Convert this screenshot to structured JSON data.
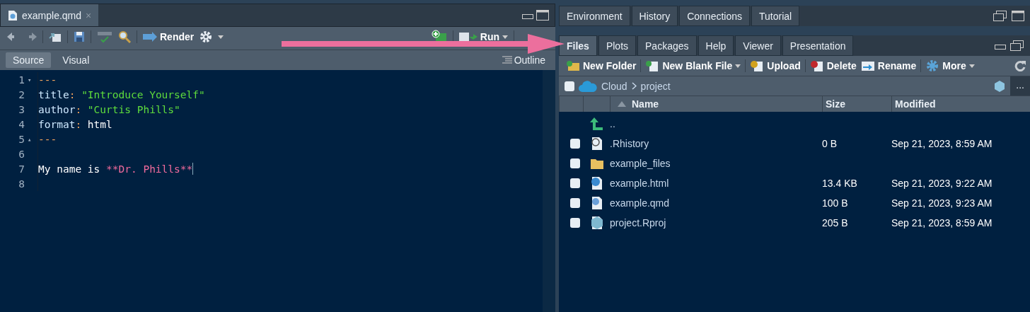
{
  "editor": {
    "file_tab": {
      "label": "example.qmd",
      "close": "×"
    },
    "toolbar": {
      "render": "Render",
      "run": "Run"
    },
    "mode_tabs": [
      {
        "label": "Source",
        "selected": true
      },
      {
        "label": "Visual",
        "selected": false
      }
    ],
    "outline": "Outline",
    "lines": [
      {
        "number": "1",
        "fold": "▾",
        "tokens": [
          {
            "kind": "dash",
            "text": "---"
          }
        ]
      },
      {
        "number": "2",
        "tokens": [
          {
            "kind": "key",
            "text": "title"
          },
          {
            "kind": "punct",
            "text": ": "
          },
          {
            "kind": "string",
            "text": "\"Introduce Yourself\""
          }
        ]
      },
      {
        "number": "3",
        "tokens": [
          {
            "kind": "key",
            "text": "author"
          },
          {
            "kind": "punct",
            "text": ": "
          },
          {
            "kind": "string",
            "text": "\"Curtis Phills\""
          }
        ]
      },
      {
        "number": "4",
        "tokens": [
          {
            "kind": "key",
            "text": "format"
          },
          {
            "kind": "punct",
            "text": ": "
          },
          {
            "kind": "plain",
            "text": "html"
          }
        ]
      },
      {
        "number": "5",
        "fold": "▴",
        "tokens": [
          {
            "kind": "dash",
            "text": "---"
          }
        ]
      },
      {
        "number": "6"
      },
      {
        "number": "7",
        "cursor": true,
        "tokens": [
          {
            "kind": "plain",
            "text": "My name is "
          },
          {
            "kind": "bold",
            "text": "**Dr. Phills**"
          }
        ]
      },
      {
        "number": "8"
      }
    ]
  },
  "files_pane": {
    "top_tabs": [
      {
        "label": "Environment",
        "selected": false
      },
      {
        "label": "History",
        "selected": false
      },
      {
        "label": "Connections",
        "selected": false
      },
      {
        "label": "Tutorial",
        "selected": false
      }
    ],
    "tabs": [
      {
        "label": "Files",
        "selected": true
      },
      {
        "label": "Plots",
        "selected": false
      },
      {
        "label": "Packages",
        "selected": false
      },
      {
        "label": "Help",
        "selected": false
      },
      {
        "label": "Viewer",
        "selected": false
      },
      {
        "label": "Presentation",
        "selected": false
      }
    ],
    "toolbar": [
      {
        "kind": "new-folder",
        "label": "New Folder",
        "dropdown": false
      },
      {
        "kind": "new-file",
        "label": "New Blank File",
        "dropdown": true
      },
      {
        "kind": "upload",
        "label": "Upload",
        "dropdown": false
      },
      {
        "kind": "delete",
        "label": "Delete",
        "dropdown": false
      },
      {
        "kind": "rename",
        "label": "Rename",
        "dropdown": false
      },
      {
        "kind": "more",
        "label": "More",
        "dropdown": true
      }
    ],
    "select_all": {
      "checked": false
    },
    "breadcrumb": [
      "Cloud",
      "project"
    ],
    "more": "...",
    "columns": [
      "Name",
      "Size",
      "Modified"
    ],
    "up_row": "..",
    "files": [
      {
        "kind": "history",
        "name": ".Rhistory",
        "size": "0 B",
        "modified": "Sep 21, 2023, 8:59 AM",
        "checked": false
      },
      {
        "kind": "folder",
        "name": "example_files",
        "checked": false
      },
      {
        "kind": "html",
        "name": "example.html",
        "size": "13.4 KB",
        "modified": "Sep 21, 2023, 9:22 AM",
        "checked": false
      },
      {
        "kind": "qmd",
        "name": "example.qmd",
        "size": "100 B",
        "modified": "Sep 21, 2023, 9:23 AM",
        "checked": false
      },
      {
        "kind": "rproj",
        "name": "project.Rproj",
        "size": "205 B",
        "modified": "Sep 21, 2023, 8:59 AM",
        "checked": false
      }
    ]
  }
}
